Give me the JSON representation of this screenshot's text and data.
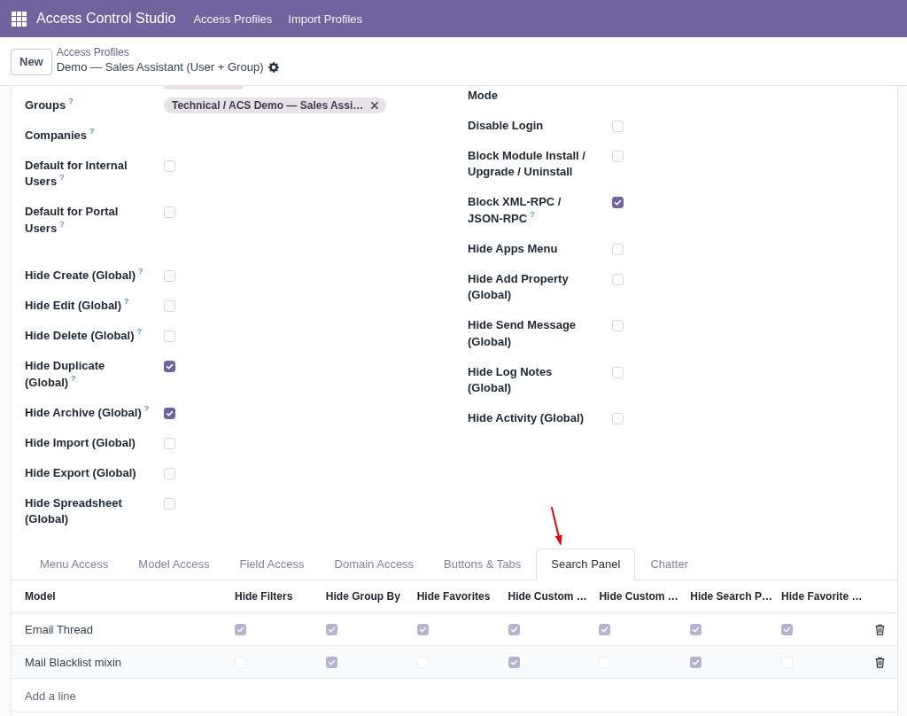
{
  "navbar": {
    "app_name": "Access Control Studio",
    "menu": [
      "Access Profiles",
      "Import Profiles"
    ]
  },
  "control_panel": {
    "new_button": "New",
    "breadcrumb": "Access Profiles",
    "record_title": "Demo — Sales Assistant (User + Group)"
  },
  "form": {
    "columns": [
      {
        "groups": [
          {
            "fields": [
              {
                "kind": "tags",
                "label": "Groups",
                "help": "?",
                "tags": [
                  "Technical / ACS Demo — Sales Assi…"
                ]
              },
              {
                "kind": "text",
                "label": "Companies",
                "help": "?"
              },
              {
                "kind": "checkbox",
                "label": "Default for Internal Users",
                "help": "?",
                "checked": false
              },
              {
                "kind": "checkbox",
                "label": "Default for Portal Users",
                "help": "?",
                "checked": false
              }
            ]
          },
          {
            "fields": [
              {
                "kind": "checkbox",
                "label": "Hide Create (Global)",
                "help": "?",
                "checked": false
              },
              {
                "kind": "checkbox",
                "label": "Hide Edit (Global)",
                "help": "?",
                "checked": false
              },
              {
                "kind": "checkbox",
                "label": "Hide Delete (Global)",
                "help": "?",
                "checked": false
              },
              {
                "kind": "checkbox",
                "label": "Hide Duplicate (Global)",
                "help": "?",
                "checked": true
              },
              {
                "kind": "checkbox",
                "label": "Hide Archive (Global)",
                "help": "?",
                "checked": true
              },
              {
                "kind": "checkbox",
                "label": "Hide Import (Global)",
                "checked": false
              },
              {
                "kind": "checkbox",
                "label": "Hide Export (Global)",
                "checked": false
              },
              {
                "kind": "checkbox",
                "label": "Hide Spreadsheet (Global)",
                "checked": false
              }
            ]
          }
        ]
      },
      {
        "groups": [
          {
            "fields": [
              {
                "kind": "text",
                "label": "Mode"
              },
              {
                "kind": "checkbox",
                "label": "Disable Login",
                "checked": false
              },
              {
                "kind": "checkbox",
                "label": "Block Module Install / Upgrade / Uninstall",
                "checked": false
              },
              {
                "kind": "checkbox",
                "label": "Block XML-RPC / JSON-RPC",
                "help": "?",
                "checked": true
              },
              {
                "kind": "checkbox",
                "label": "Hide Apps Menu",
                "checked": false
              },
              {
                "kind": "checkbox",
                "label": "Hide Add Property (Global)",
                "checked": false
              },
              {
                "kind": "checkbox",
                "label": "Hide Send Message (Global)",
                "checked": false
              },
              {
                "kind": "checkbox",
                "label": "Hide Log Notes (Global)",
                "checked": false
              },
              {
                "kind": "checkbox",
                "label": "Hide Activity (Global)",
                "checked": false
              }
            ]
          }
        ]
      }
    ]
  },
  "tabs": [
    {
      "label": "Menu Access",
      "selected": false
    },
    {
      "label": "Model Access",
      "selected": false
    },
    {
      "label": "Field Access",
      "selected": false
    },
    {
      "label": "Domain Access",
      "selected": false
    },
    {
      "label": "Buttons & Tabs",
      "selected": false
    },
    {
      "label": "Search Panel",
      "selected": true
    },
    {
      "label": "Chatter",
      "selected": false
    }
  ],
  "table": {
    "columns": [
      "Model",
      "Hide Filters",
      "Hide Group By",
      "Hide Favorites",
      "Hide Custom …",
      "Hide Custom …",
      "Hide Search P…",
      "Hide Favorite …"
    ],
    "rows": [
      {
        "model": "Email Thread",
        "cells": [
          {
            "checked": true
          },
          {
            "checked": true
          },
          {
            "checked": true
          },
          {
            "checked": true
          },
          {
            "checked": true
          },
          {
            "checked": true
          },
          {
            "checked": true
          }
        ]
      },
      {
        "model": "Mail Blacklist mixin",
        "cells": [
          {
            "checked": false
          },
          {
            "checked": true
          },
          {
            "checked": false
          },
          {
            "checked": true
          },
          {
            "checked": false
          },
          {
            "checked": true
          },
          {
            "checked": false
          }
        ]
      }
    ],
    "add_line": "Add a line"
  }
}
